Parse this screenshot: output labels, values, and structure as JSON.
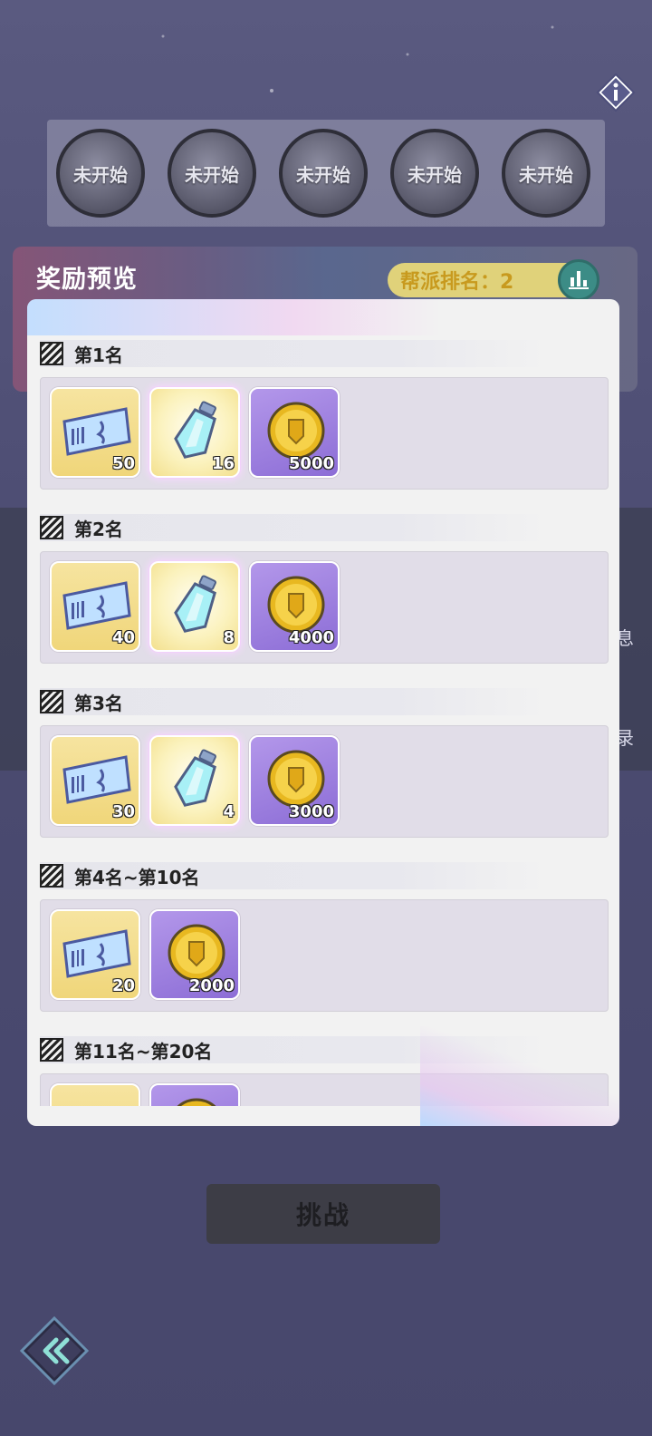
{
  "stages": [
    {
      "status": "未开始"
    },
    {
      "status": "未开始"
    },
    {
      "status": "未开始"
    },
    {
      "status": "未开始"
    },
    {
      "status": "未开始"
    }
  ],
  "reward_preview": {
    "title": "奖励预览",
    "guild_rank": "帮派排名：2"
  },
  "side_labels": {
    "a": "息",
    "b": "录"
  },
  "tiers": [
    {
      "label": "第1名",
      "items": [
        {
          "type": "ticket",
          "count": "50"
        },
        {
          "type": "gem",
          "count": "16"
        },
        {
          "type": "coin",
          "count": "5000"
        }
      ]
    },
    {
      "label": "第2名",
      "items": [
        {
          "type": "ticket",
          "count": "40"
        },
        {
          "type": "gem",
          "count": "8"
        },
        {
          "type": "coin",
          "count": "4000"
        }
      ]
    },
    {
      "label": "第3名",
      "items": [
        {
          "type": "ticket",
          "count": "30"
        },
        {
          "type": "gem",
          "count": "4"
        },
        {
          "type": "coin",
          "count": "3000"
        }
      ]
    },
    {
      "label": "第4名~第10名",
      "items": [
        {
          "type": "ticket",
          "count": "20"
        },
        {
          "type": "coin",
          "count": "2000"
        }
      ]
    },
    {
      "label": "第11名~第20名",
      "items": [
        {
          "type": "ticket",
          "count": ""
        },
        {
          "type": "coin",
          "count": ""
        }
      ]
    }
  ],
  "challenge_button": "挑战",
  "icons": {
    "info": "info-icon",
    "rank": "bar-chart-icon",
    "back": "double-chevron-left-icon",
    "tier": "stripe-icon"
  },
  "colors": {
    "panel": "#f2f2f2",
    "rank_pill": "#e0d27a",
    "coin_bg": "#8c6dd6",
    "ticket_bg": "#f0d67a"
  }
}
